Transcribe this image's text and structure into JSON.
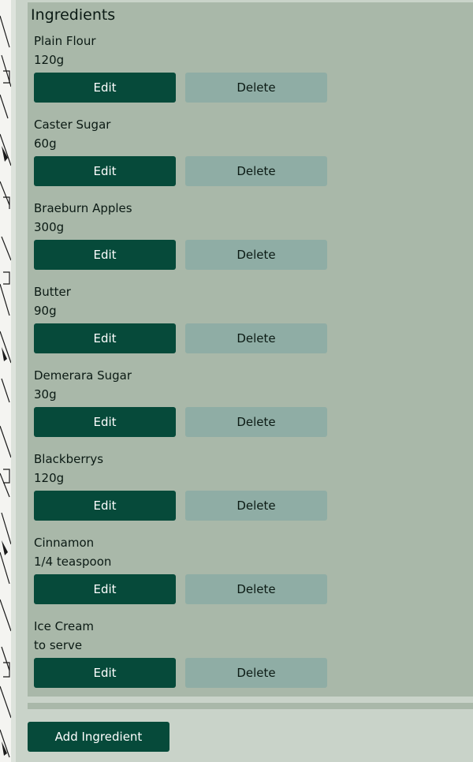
{
  "panel": {
    "title": "Ingredients"
  },
  "ingredients": [
    {
      "name": "Plain Flour",
      "quantity": "120g",
      "edit_label": "Edit",
      "delete_label": "Delete"
    },
    {
      "name": "Caster Sugar",
      "quantity": "60g",
      "edit_label": "Edit",
      "delete_label": "Delete"
    },
    {
      "name": "Braeburn Apples",
      "quantity": "300g",
      "edit_label": "Edit",
      "delete_label": "Delete"
    },
    {
      "name": "Butter",
      "quantity": "90g",
      "edit_label": "Edit",
      "delete_label": "Delete"
    },
    {
      "name": "Demerara Sugar",
      "quantity": "30g",
      "edit_label": "Edit",
      "delete_label": "Delete"
    },
    {
      "name": "Blackberrys",
      "quantity": "120g",
      "edit_label": "Edit",
      "delete_label": "Delete"
    },
    {
      "name": "Cinnamon",
      "quantity": "1/4 teaspoon",
      "edit_label": "Edit",
      "delete_label": "Delete"
    },
    {
      "name": "Ice Cream",
      "quantity": "to serve",
      "edit_label": "Edit",
      "delete_label": "Delete"
    }
  ],
  "actions": {
    "add_label": "Add Ingredient"
  },
  "colors": {
    "primary": "#064a3a",
    "secondary": "#8fada5",
    "panel": "#a9b8a9",
    "page": "#c9d3c9"
  }
}
